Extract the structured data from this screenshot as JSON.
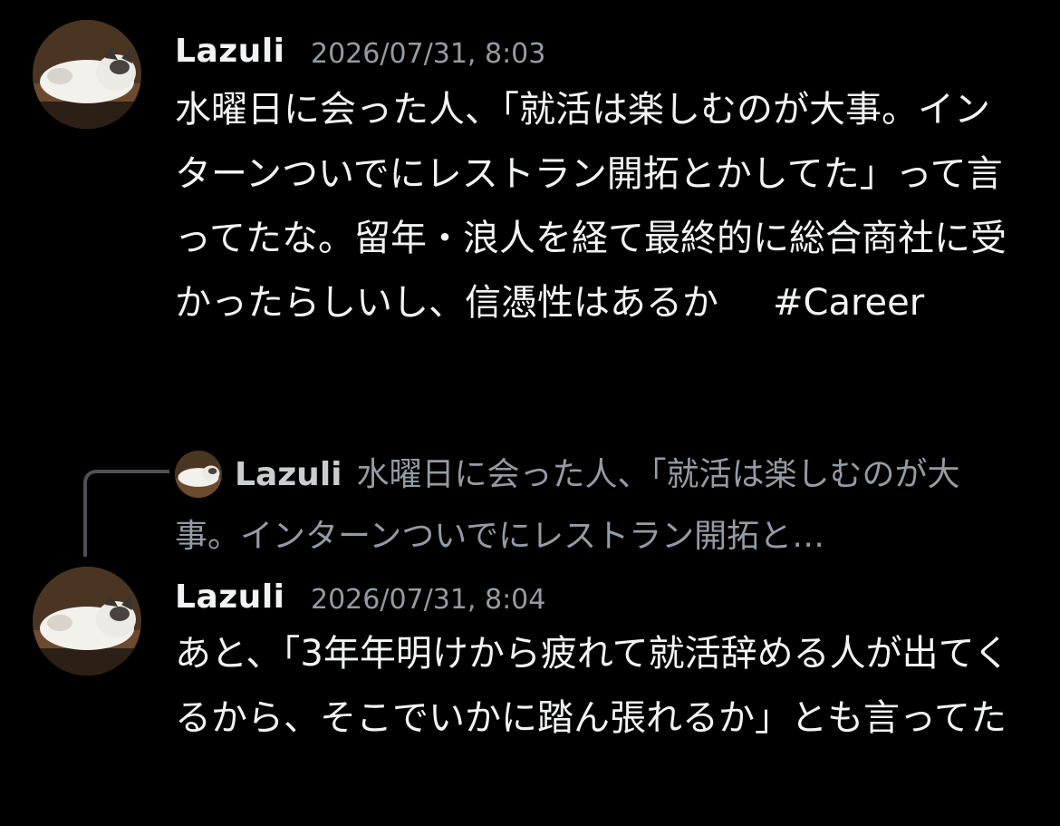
{
  "messages": [
    {
      "username": "Lazuli",
      "timestamp": "2026/07/31, 8:03",
      "text": "水曜日に会った人、「就活は楽しむのが大事。インターンついでにレストラン開拓とかしてた」って言ってたな。留年・浪人を経て最終的に総合商社に受かったらしいし、信憑性はあるか",
      "hashtag": "#Career",
      "avatar_icon": "cat-avatar-icon"
    },
    {
      "username": "Lazuli",
      "timestamp": "2026/07/31, 8:04",
      "text": "あと、「3年年明けから疲れて就活辞める人が出てくるから、そこでいかに踏ん張れるか」とも言ってた",
      "avatar_icon": "cat-avatar-icon"
    }
  ],
  "reply_preview": {
    "username": "Lazuli",
    "text": "水曜日に会った人、「就活は楽しむのが大事。インターンついでにレストラン開拓と…"
  },
  "colors": {
    "background": "#000000",
    "text": "#f2f3f5",
    "muted": "#949ba4",
    "reply_line": "#4e5058"
  }
}
